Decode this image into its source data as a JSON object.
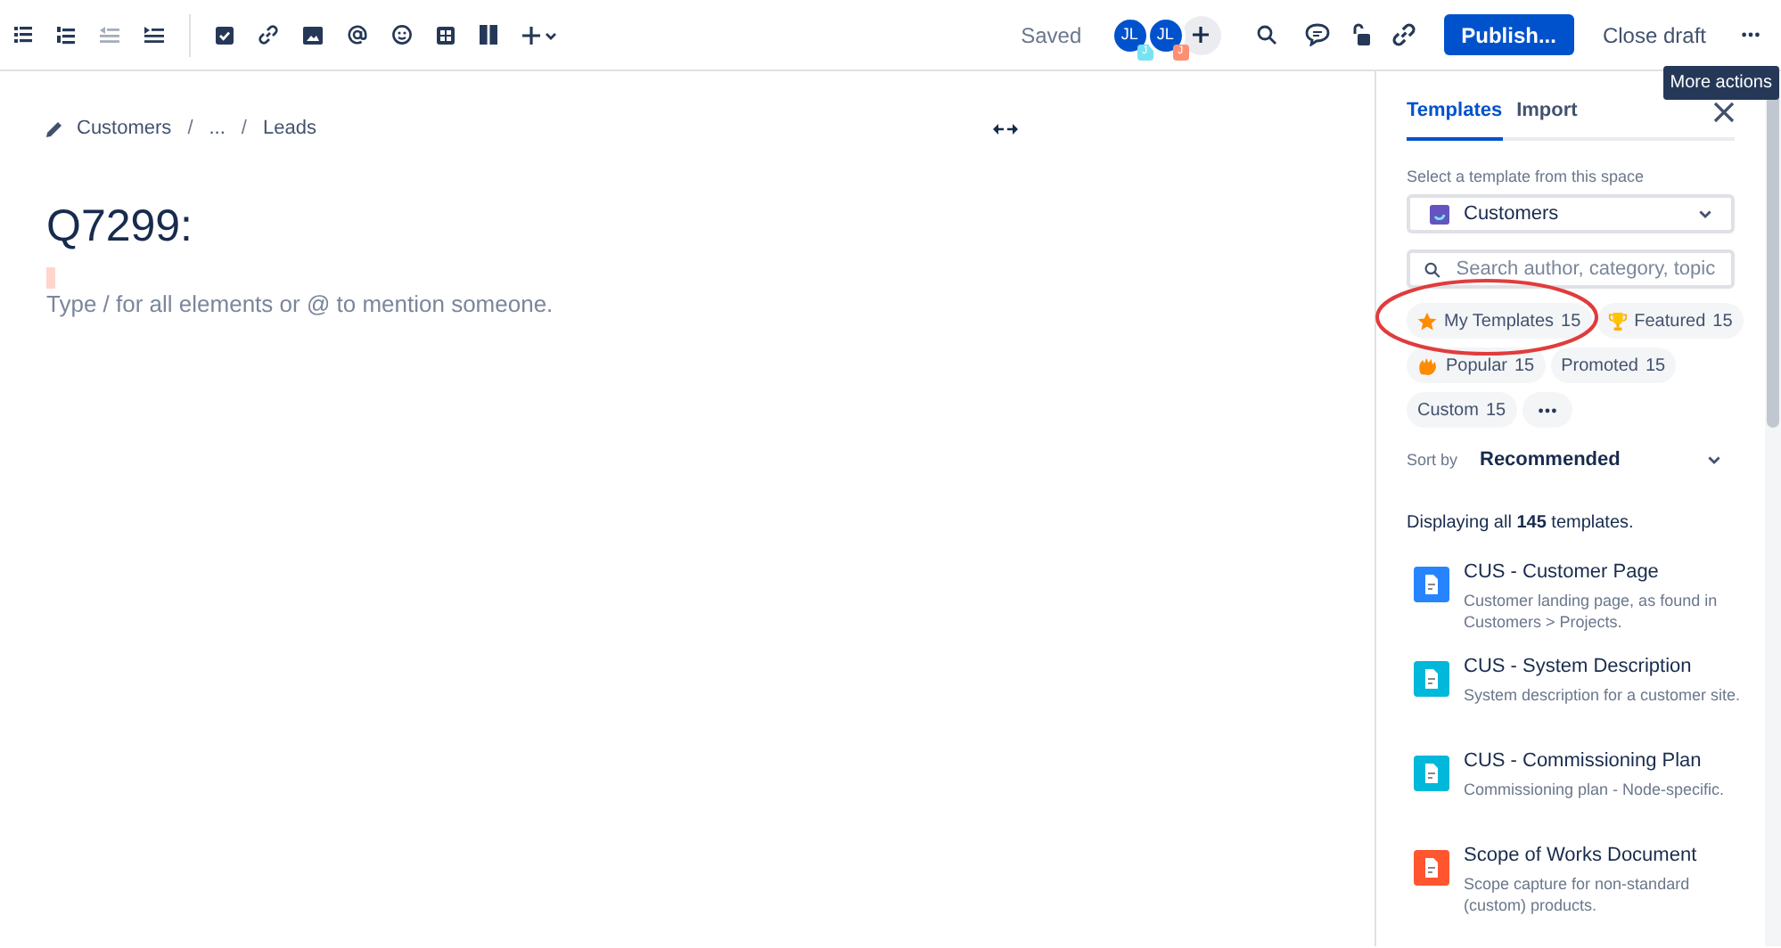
{
  "toolbar": {
    "saved": "Saved",
    "avatars": [
      {
        "initials": "JL",
        "badge": "J",
        "color": "#79e2f2"
      },
      {
        "initials": "JL",
        "badge": "J",
        "color": "#ff8f73"
      }
    ],
    "publish": "Publish...",
    "close_draft": "Close draft",
    "tooltip": "More actions"
  },
  "breadcrumbs": [
    {
      "kind": "link",
      "label": "Customers"
    },
    {
      "kind": "separator",
      "label": "/"
    },
    {
      "kind": "link",
      "label": "..."
    },
    {
      "kind": "separator",
      "label": "/"
    },
    {
      "kind": "link",
      "label": "Leads"
    }
  ],
  "page": {
    "title": "Q7299:",
    "placeholder": "Type / for all elements or @ to mention someone."
  },
  "panel": {
    "tabs": [
      {
        "label": "Templates",
        "selected": true
      },
      {
        "label": "Import",
        "selected": false
      }
    ],
    "space_label": "Select a template from this space",
    "space": "Customers",
    "search": {
      "placeholder": "Search author, category, topic"
    },
    "chips": [
      {
        "kind": "star",
        "label": "My Templates",
        "count": "15"
      },
      {
        "kind": "trophy",
        "label": "Featured",
        "count": "15"
      },
      {
        "kind": "hand",
        "label": "Popular",
        "count": "15"
      },
      {
        "kind": "plain",
        "label": "Promoted",
        "count": "15"
      },
      {
        "kind": "plain",
        "label": "Custom",
        "count": "15"
      },
      {
        "kind": "more"
      }
    ],
    "sort_label": "Sort by",
    "sort": "Recommended",
    "summary": "Displaying all **145** templates.",
    "templates": [
      {
        "title": "CUS - Customer Page",
        "description": "Customer landing page, as found in Customers > Projects.",
        "color": "#2684ff"
      },
      {
        "title": "CUS - System Description",
        "description": "System description for a customer site.",
        "color": "#00b8d9"
      },
      {
        "title": "CUS - Commissioning Plan",
        "description": "Commissioning plan - Node-specific.",
        "color": "#00b8d9"
      },
      {
        "title": "Scope of Works Document",
        "description": "Scope capture for non-standard (custom) products.",
        "color": "#ff5630"
      }
    ]
  }
}
